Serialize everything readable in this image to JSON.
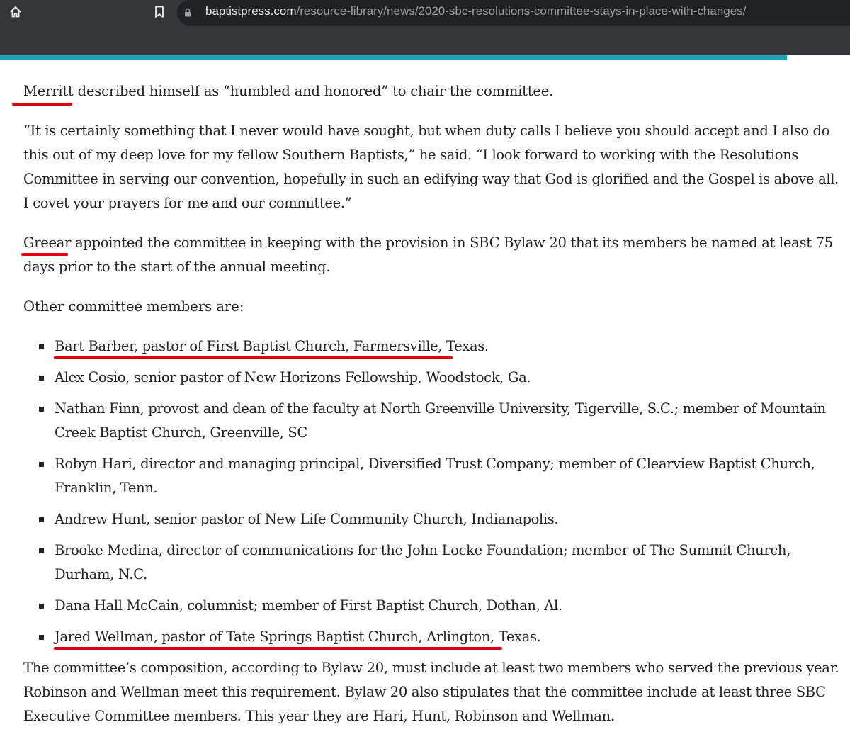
{
  "browser": {
    "url_domain": "baptistpress.com",
    "url_path": "/resource-library/news/2020-sbc-resolutions-committee-stays-in-place-with-changes/",
    "icons": {
      "home": "home-icon",
      "bookmark": "bookmark-icon",
      "lock": "lock-icon"
    },
    "progress_fraction": 0.926,
    "colors": {
      "toolbar": "#35363a",
      "omnibox": "#202124",
      "progress": "#18a6b5",
      "annotation": "#e0000b"
    }
  },
  "article": {
    "p1": {
      "name": "Merritt",
      "rest": " described himself as “humbled and honored” to chair the committee."
    },
    "p2": "“It is certainly something that I never would have sought, but when duty calls I believe you should accept and I also do this out of my deep love for my fellow Southern Baptists,” he said. “I look forward to working with the Resolutions Committee in serving our convention, hopefully in such an edifying way that God is glorified and the Gospel is above all. I covet your prayers for me and our committee.”",
    "p3": {
      "name": "Greear",
      "rest": " appointed the committee in keeping with the provision in SBC Bylaw 20 that its members be named at least 75 days prior to the start of the annual meeting."
    },
    "p4": "Other committee members are:",
    "members": [
      "Bart Barber, pastor of First Baptist Church, Farmersville, Texas.",
      "Alex Cosio, senior pastor of New Horizons Fellowship, Woodstock, Ga.",
      "Nathan Finn, provost and dean of the faculty at North Greenville University, Tigerville, S.C.; member of Mountain Creek Baptist Church, Greenville, SC",
      "Robyn Hari, director and managing principal, Diversified Trust Company; member of Clearview Baptist Church, Franklin, Tenn.",
      "Andrew Hunt, senior pastor of New Life Community Church, Indianapolis.",
      "Brooke Medina, director of communications for the John Locke Foundation; member of The Summit Church, Durham, N.C.",
      "Dana Hall McCain, columnist; member of First Baptist Church, Dothan, Al.",
      "Jared Wellman, pastor of Tate Springs Baptist Church, Arlington, Texas."
    ],
    "p5": "The committee’s composition, according to Bylaw 20, must include at least two members who served the previous year. Robinson and Wellman meet this requirement. Bylaw 20 also stipulates that the committee include at least three SBC Executive Committee members. This year they are Hari, Hunt, Robinson and Wellman."
  }
}
